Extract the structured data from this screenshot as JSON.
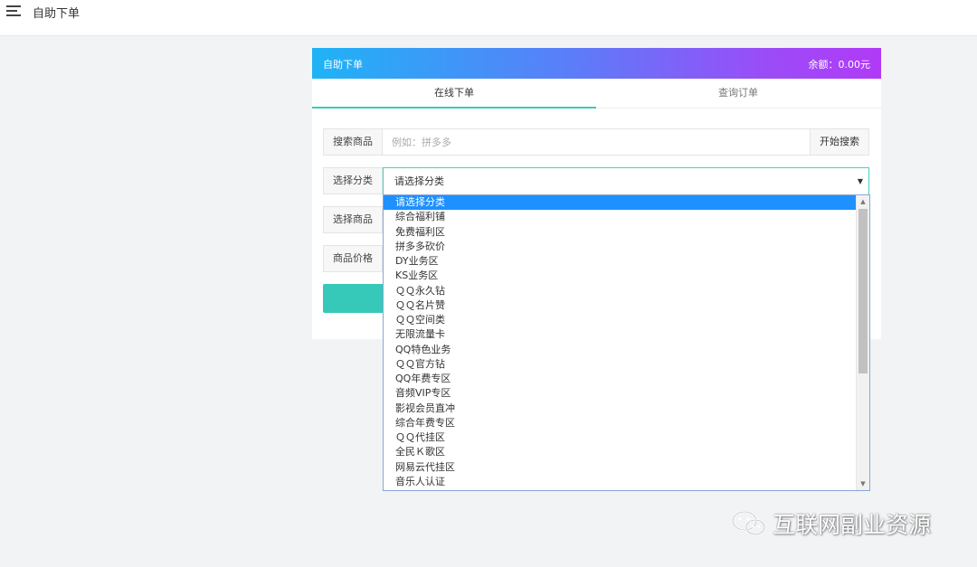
{
  "topbar": {
    "title": "自助下单"
  },
  "card": {
    "header_title": "自助下单",
    "balance": "余额：0.00元"
  },
  "tabs": [
    {
      "label": "在线下单",
      "active": true
    },
    {
      "label": "查询订单",
      "active": false
    }
  ],
  "form": {
    "search_label": "搜索商品",
    "search_placeholder": "例如：拼多多",
    "search_button": "开始搜索",
    "category_label": "选择分类",
    "category_selected": "请选择分类",
    "product_label": "选择商品",
    "price_label": "商品价格"
  },
  "dropdown": {
    "options": [
      "请选择分类",
      "综合福利铺",
      "免费福利区",
      "拼多多砍价",
      "DY业务区",
      "KS业务区",
      "ＱＱ永久钻",
      "ＱＱ名片赞",
      "ＱＱ空间类",
      "无限流量卡",
      "QQ特色业务",
      "ＱＱ官方钻",
      "QQ年费专区",
      "音频VIP专区",
      "影视会员直冲",
      "综合年费专区",
      "ＱＱ代挂区",
      "全民Ｋ歌区",
      "网易云代挂区",
      "音乐人认证"
    ],
    "selected_index": 0
  },
  "watermark": {
    "text": "互联网副业资源",
    "icon": "wechat-icon"
  },
  "colors": {
    "header_gradient_start": "#1fb3f6",
    "header_gradient_end": "#b13af7",
    "accent": "#36c8b9",
    "selected_option": "#1e90ff"
  }
}
